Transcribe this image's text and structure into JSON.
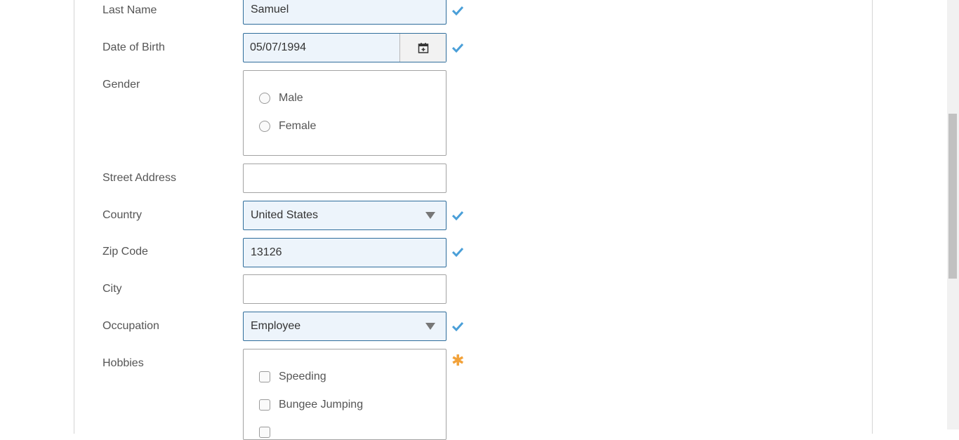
{
  "form": {
    "last_name": {
      "label": "Last Name",
      "value": "Samuel"
    },
    "dob": {
      "label": "Date of Birth",
      "value": "05/07/1994"
    },
    "gender": {
      "label": "Gender",
      "options": [
        "Male",
        "Female"
      ]
    },
    "street": {
      "label": "Street Address",
      "value": ""
    },
    "country": {
      "label": "Country",
      "value": "United States"
    },
    "zip": {
      "label": "Zip Code",
      "value": "13126"
    },
    "city": {
      "label": "City",
      "value": ""
    },
    "occupation": {
      "label": "Occupation",
      "value": "Employee"
    },
    "hobbies": {
      "label": "Hobbies",
      "options": [
        "Speeding",
        "Bungee Jumping"
      ]
    }
  },
  "colors": {
    "valid_border": "#2f6d9b",
    "valid_bg": "#edf4fb",
    "check": "#4a9fd8",
    "required_star": "#f2a23a"
  },
  "icons": {
    "valid": "checkmark-icon",
    "required": "asterisk-icon",
    "calendar": "calendar-icon"
  }
}
